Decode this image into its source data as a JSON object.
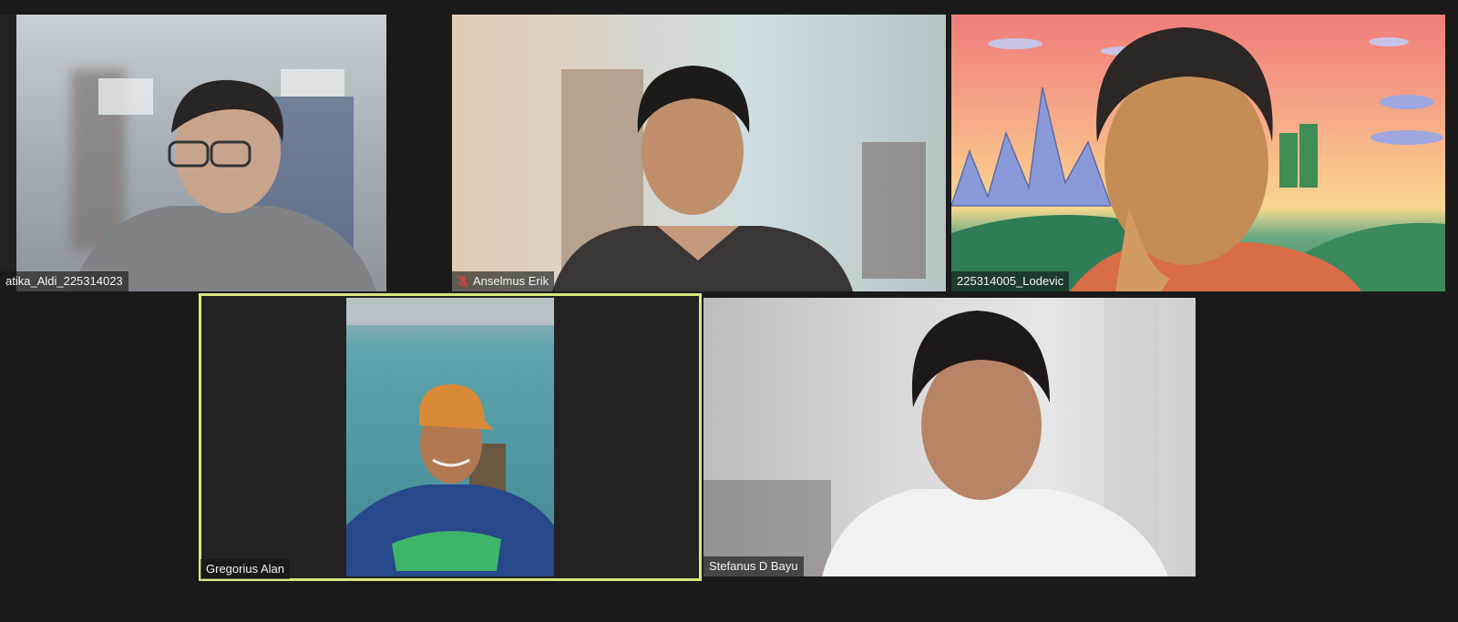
{
  "app": {
    "window_type": "video-conference-gallery-view",
    "colors": {
      "background": "#1a1a1a",
      "active_speaker_border": "#d9e87c",
      "name_tag_bg": "rgba(20,20,20,0.62)",
      "muted_icon": "#e0413b"
    }
  },
  "participants": [
    {
      "name": "atika_Aldi_225314023",
      "muted": false
    },
    {
      "name": "Anselmus Erik",
      "muted": true,
      "icon": "muted-mic-icon"
    },
    {
      "name": "225314005_Lodevic",
      "muted": false
    },
    {
      "name": "Gregorius Alan",
      "muted": false,
      "active_speaker": true
    },
    {
      "name": "Stefanus D Bayu",
      "muted": false
    }
  ]
}
